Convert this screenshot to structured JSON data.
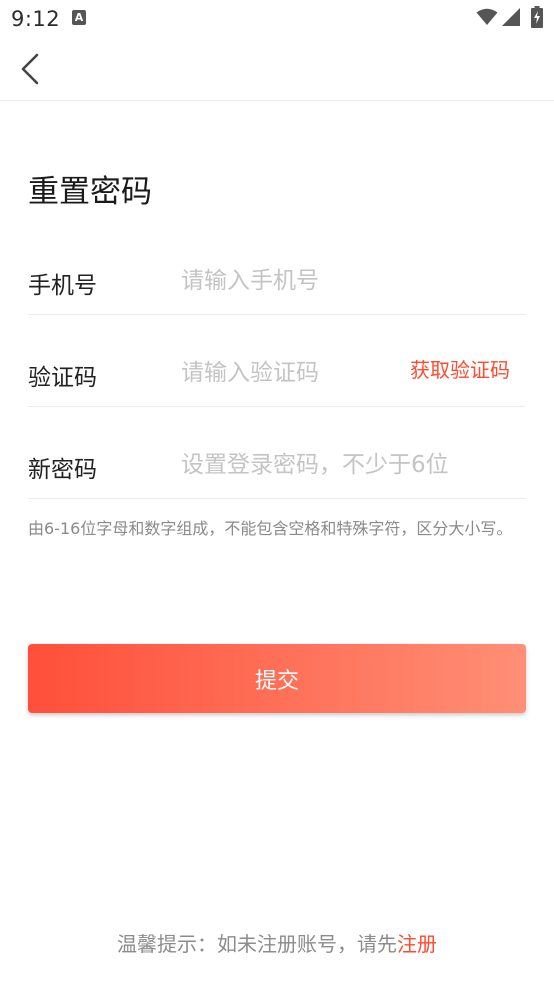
{
  "status_bar": {
    "time": "9:12",
    "notification_icon": "A",
    "icons": [
      "wifi-icon",
      "signal-icon",
      "battery-charging-icon"
    ]
  },
  "nav": {
    "back_icon": "chevron-left-icon"
  },
  "title": "重置密码",
  "form": {
    "phone": {
      "label": "手机号",
      "value": "",
      "placeholder": "请输入手机号"
    },
    "code": {
      "label": "验证码",
      "value": "",
      "placeholder": "请输入验证码",
      "action_label": "获取验证码"
    },
    "password": {
      "label": "新密码",
      "value": "",
      "placeholder": "设置登录密码，不少于6位"
    }
  },
  "hint": "由6-16位字母和数字组成，不能包含空格和特殊字符，区分大小写。",
  "submit_label": "提交",
  "footer": {
    "tip_text": "温馨提示：如未注册账号，请先",
    "register_link": "注册"
  },
  "colors": {
    "accent": "#ff4a2e",
    "button_gradient_start": "#ff4f3a",
    "button_gradient_end": "#ff8f75",
    "placeholder": "#c4c4c4",
    "hint_text": "#8a8a8a"
  }
}
